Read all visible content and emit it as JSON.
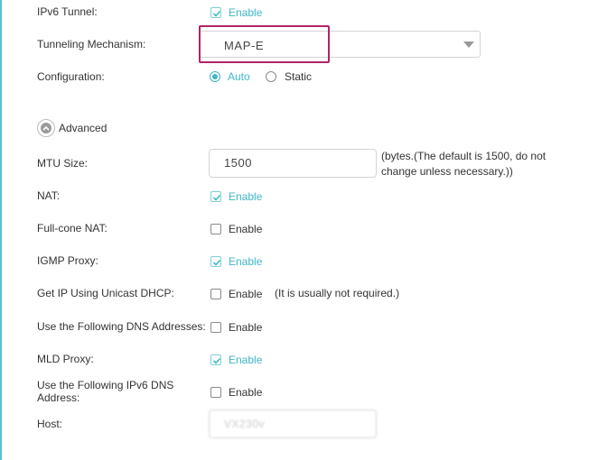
{
  "ipv6_tunnel": {
    "label": "IPv6 Tunnel:",
    "enable_label": "Enable",
    "checked": true
  },
  "tunneling_mechanism": {
    "label": "Tunneling Mechanism:",
    "value": "MAP-E"
  },
  "configuration": {
    "label": "Configuration:",
    "options": [
      "Auto",
      "Static"
    ],
    "selected": "Auto"
  },
  "advanced": {
    "label": "Advanced"
  },
  "mtu": {
    "label": "MTU Size:",
    "value": "1500",
    "note_line1": "(bytes.(The default is 1500, do not",
    "note_line2": "change unless necessary.))"
  },
  "nat": {
    "label": "NAT:",
    "enable_label": "Enable",
    "checked": true
  },
  "full_cone_nat": {
    "label": "Full-cone NAT:",
    "enable_label": "Enable",
    "checked": false
  },
  "igmp_proxy": {
    "label": "IGMP Proxy:",
    "enable_label": "Enable",
    "checked": true
  },
  "unicast_dhcp": {
    "label": "Get IP Using Unicast DHCP:",
    "enable_label": "Enable",
    "checked": false,
    "note": "(It is usually not required.)"
  },
  "dns_addresses": {
    "label": "Use the Following DNS Addresses:",
    "enable_label": "Enable",
    "checked": false
  },
  "mld_proxy": {
    "label": "MLD Proxy:",
    "enable_label": "Enable",
    "checked": true
  },
  "ipv6_dns": {
    "label_line1": "Use the Following IPv6 DNS",
    "label_line2": "Address:",
    "enable_label": "Enable",
    "checked": false
  },
  "host": {
    "label": "Host:",
    "value": "VX230v"
  },
  "colors": {
    "accent": "#3fb6c8",
    "highlight": "#b2246a",
    "sidebar": "#5bc0d0"
  }
}
